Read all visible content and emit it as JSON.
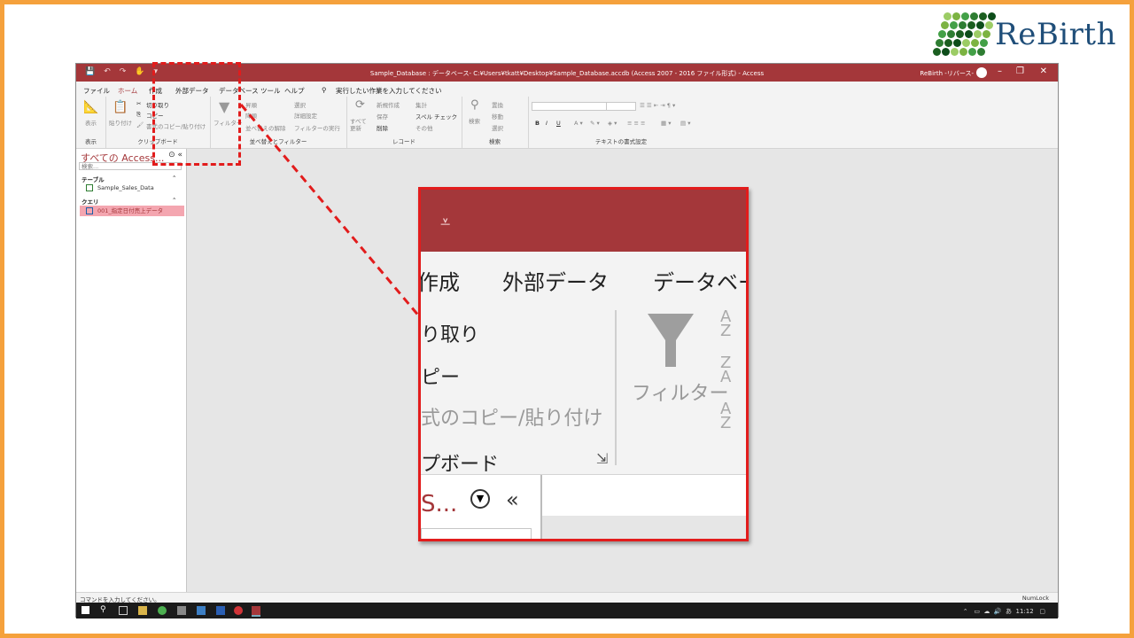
{
  "logo": {
    "text": "ReBirth"
  },
  "window": {
    "title": "Sample_Database : データベース- C:¥Users¥tkatt¥Desktop¥Sample_Database.accdb (Access 2007 - 2016 ファイル形式)  -  Access",
    "user": "ReBirth -リバース-",
    "minimize": "–",
    "maximize": "❐",
    "close": "✕"
  },
  "menu": {
    "file": "ファイル",
    "home": "ホーム",
    "create": "作成",
    "external": "外部データ",
    "dbtools": "データベース ツール",
    "help": "ヘルプ",
    "search_placeholder": "実行したい作業を入力してください"
  },
  "ribbon": {
    "view_btn": "表示",
    "view_group": "表示",
    "paste_btn": "貼り付け",
    "cut": "切り取り",
    "copy": "コピー",
    "format_painter": "書式のコピー/貼り付け",
    "clipboard_group": "クリップボード",
    "filter_btn": "フィルター",
    "ascending": "昇順",
    "descending": "降順",
    "remove_sort": "並べ替えの解除",
    "selection": "選択",
    "advanced": "詳細設定",
    "toggle_filter": "フィルターの実行",
    "sort_group": "並べ替えとフィルター",
    "refresh_btn": "すべて更新",
    "new": "新規作成",
    "save": "保存",
    "delete": "削除",
    "totals": "集計",
    "spelling": "スペル チェック",
    "more": "その他",
    "records_group": "レコード",
    "find_btn": "検索",
    "replace": "置換",
    "goto": "移動",
    "select": "選択",
    "find_group": "検索",
    "text_format_group": "テキストの書式設定",
    "bold": "B",
    "italic": "I",
    "underline": "U"
  },
  "nav": {
    "title": "すべての Access...",
    "search_placeholder": "検索...",
    "tables_header": "テーブル",
    "table_item": "Sample_Sales_Data",
    "queries_header": "クエリ",
    "query_item": "001_指定日付売上データ"
  },
  "status": {
    "left": "コマンドを入力してください。",
    "right": "NumLock"
  },
  "taskbar": {
    "time": "11:12"
  },
  "zoom": {
    "create": "作成",
    "external": "外部データ",
    "dbtools": "データベー",
    "cut": "り取り",
    "copy": "ピー",
    "format_painter": "式のコピー/貼り付け",
    "clipboard": "プボード",
    "filter": "フィルター",
    "nav_title": "S...",
    "nav_collapse": "«"
  },
  "colors": {
    "accent": "#a4373a",
    "callout": "#e21c1c",
    "frame": "#f5a13c",
    "logo": "#1f4e79"
  }
}
